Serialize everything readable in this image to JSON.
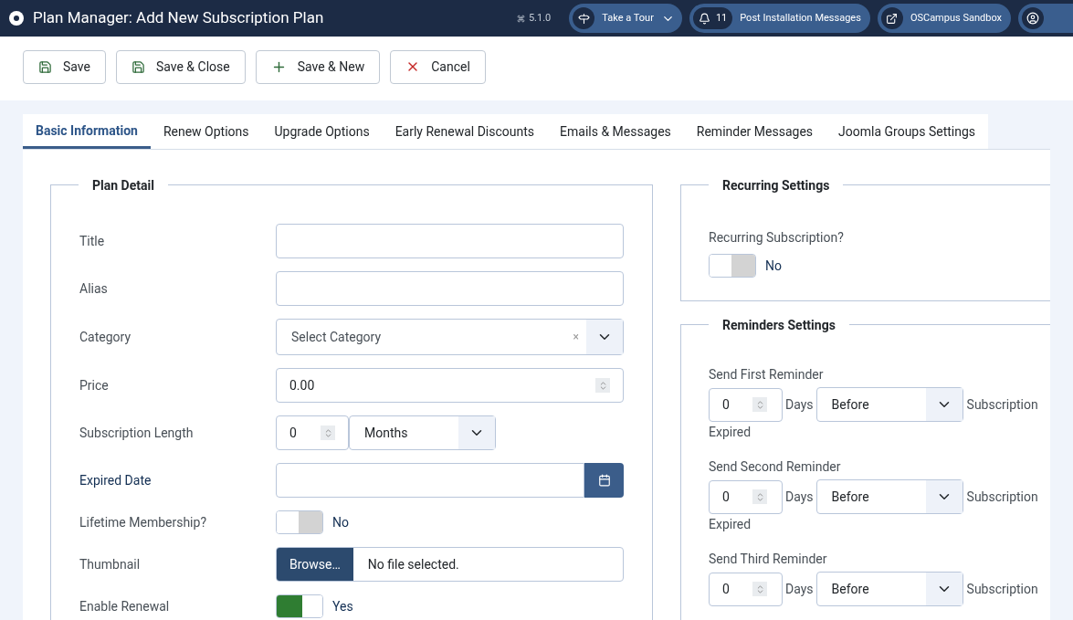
{
  "header": {
    "title": "Plan Manager: Add New Subscription Plan",
    "version": "5.1.0",
    "buttons": [
      {
        "kind": "tour",
        "label": "Take a Tour"
      },
      {
        "kind": "messages",
        "count": "11",
        "label": "Post Installation Messages"
      },
      {
        "kind": "site",
        "label": "OSCampus Sandbox"
      },
      {
        "kind": "user"
      }
    ]
  },
  "toolbar": [
    {
      "kind": "save",
      "label": "Save"
    },
    {
      "kind": "save",
      "label": "Save & Close"
    },
    {
      "kind": "new",
      "label": "Save & New"
    },
    {
      "kind": "cancel",
      "label": "Cancel"
    }
  ],
  "tabs": [
    {
      "label": "Basic Information",
      "selected": true
    },
    {
      "label": "Renew Options",
      "selected": false
    },
    {
      "label": "Upgrade Options",
      "selected": false
    },
    {
      "label": "Early Renewal Discounts",
      "selected": false
    },
    {
      "label": "Emails & Messages",
      "selected": false
    },
    {
      "label": "Reminder Messages",
      "selected": false
    },
    {
      "label": "Joomla Groups Settings",
      "selected": false
    }
  ],
  "plan_detail": {
    "legend": "Plan Detail",
    "fields": [
      {
        "kind": "text",
        "label": "Title"
      },
      {
        "kind": "text",
        "label": "Alias"
      },
      {
        "kind": "select",
        "label": "Category",
        "placeholder": "Select Category",
        "clear": "×"
      },
      {
        "kind": "number",
        "label": "Price",
        "value": "0.00"
      },
      {
        "kind": "length",
        "label": "Subscription Length",
        "value": "0",
        "unit": "Months"
      },
      {
        "kind": "date",
        "label": "Expired Date"
      },
      {
        "kind": "toggle",
        "label": "Lifetime Membership?",
        "on": false,
        "state": "No"
      },
      {
        "kind": "file",
        "label": "Thumbnail",
        "button": "Browse…",
        "status": "No file selected."
      },
      {
        "kind": "toggle",
        "label": "Enable Renewal",
        "on": true,
        "state": "Yes"
      }
    ]
  },
  "recurring": {
    "legend": "Recurring Settings",
    "label": "Recurring Subscription?",
    "on": false,
    "state": "No"
  },
  "reminders": {
    "legend": "Reminders Settings",
    "items": [
      {
        "label": "Send First Reminder",
        "value": "0",
        "unit": "Days",
        "when": "Before",
        "suffix": "Subscription",
        "suffix_2": "Expired"
      },
      {
        "label": "Send Second Reminder",
        "value": "0",
        "unit": "Days",
        "when": "Before",
        "suffix": "Subscription",
        "suffix_2": "Expired"
      },
      {
        "label": "Send Third Reminder",
        "value": "0",
        "unit": "Days",
        "when": "Before",
        "suffix": "Subscription"
      }
    ]
  }
}
